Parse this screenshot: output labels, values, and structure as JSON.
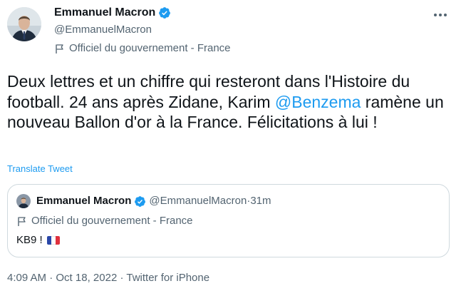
{
  "author": {
    "name": "Emmanuel Macron",
    "handle": "@EmmanuelMacron",
    "label": "Officiel du gouvernement - France"
  },
  "tweet": {
    "text_before": "Deux lettres et un chiffre qui resteront dans l'Histoire du football. 24 ans après Zidane, Karim ",
    "mention": "@Benzema",
    "text_after": " ramène un nouveau Ballon d'or à la France. Félicitations à lui !",
    "translate_label": "Translate Tweet"
  },
  "quoted": {
    "name": "Emmanuel Macron",
    "handle": "@EmmanuelMacron",
    "separator": " · ",
    "time": "31m",
    "label": "Officiel du gouvernement - France",
    "text": "KB9 !"
  },
  "footer": {
    "time": "4:09 AM",
    "sep1": " · ",
    "date": "Oct 18, 2022",
    "sep2": " · ",
    "source": "Twitter for iPhone"
  },
  "colors": {
    "accent": "#1d9bf0",
    "secondary_text": "#536471",
    "border": "#cfd9de"
  },
  "icons": {
    "verified": "verified-badge-icon",
    "flag": "flag-icon",
    "more": "more-dots-icon",
    "france_flag": "france-flag-emoji"
  }
}
